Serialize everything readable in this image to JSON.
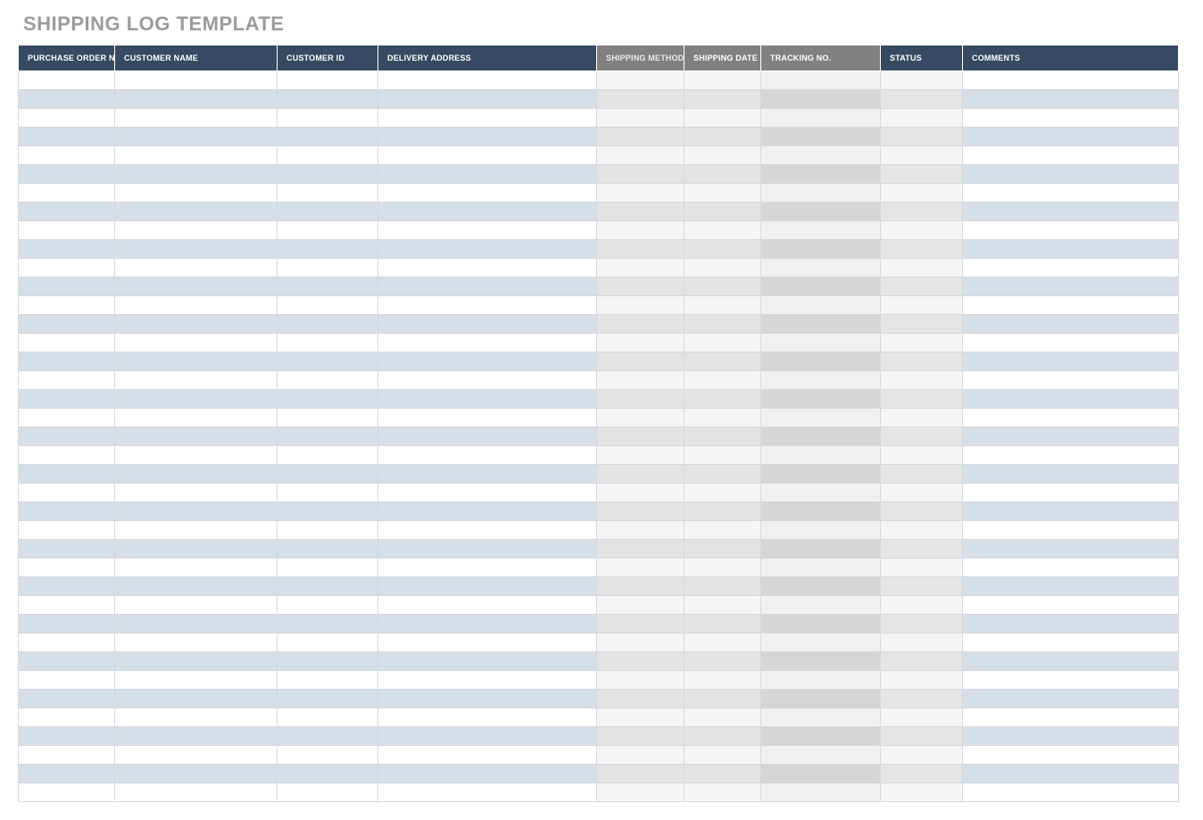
{
  "title": "SHIPPING LOG TEMPLATE",
  "columns": [
    {
      "key": "po",
      "label": "PURCHASE ORDER NO.",
      "zone": "blue"
    },
    {
      "key": "name",
      "label": "CUSTOMER NAME",
      "zone": "blue"
    },
    {
      "key": "id",
      "label": "CUSTOMER ID",
      "zone": "blue"
    },
    {
      "key": "addr",
      "label": "DELIVERY ADDRESS",
      "zone": "blue"
    },
    {
      "key": "method",
      "label": "SHIPPING METHOD",
      "zone": "gray1"
    },
    {
      "key": "date",
      "label": "SHIPPING DATE",
      "zone": "gray1"
    },
    {
      "key": "track",
      "label": "TRACKING NO.",
      "zone": "gray2"
    },
    {
      "key": "status",
      "label": "STATUS",
      "zone": "gray3"
    },
    {
      "key": "comments",
      "label": "COMMENTS",
      "zone": "blue"
    }
  ],
  "rows": [
    {
      "po": "",
      "name": "",
      "id": "",
      "addr": "",
      "method": "",
      "date": "",
      "track": "",
      "status": "",
      "comments": ""
    },
    {
      "po": "",
      "name": "",
      "id": "",
      "addr": "",
      "method": "",
      "date": "",
      "track": "",
      "status": "",
      "comments": ""
    },
    {
      "po": "",
      "name": "",
      "id": "",
      "addr": "",
      "method": "",
      "date": "",
      "track": "",
      "status": "",
      "comments": ""
    },
    {
      "po": "",
      "name": "",
      "id": "",
      "addr": "",
      "method": "",
      "date": "",
      "track": "",
      "status": "",
      "comments": ""
    },
    {
      "po": "",
      "name": "",
      "id": "",
      "addr": "",
      "method": "",
      "date": "",
      "track": "",
      "status": "",
      "comments": ""
    },
    {
      "po": "",
      "name": "",
      "id": "",
      "addr": "",
      "method": "",
      "date": "",
      "track": "",
      "status": "",
      "comments": ""
    },
    {
      "po": "",
      "name": "",
      "id": "",
      "addr": "",
      "method": "",
      "date": "",
      "track": "",
      "status": "",
      "comments": ""
    },
    {
      "po": "",
      "name": "",
      "id": "",
      "addr": "",
      "method": "",
      "date": "",
      "track": "",
      "status": "",
      "comments": ""
    },
    {
      "po": "",
      "name": "",
      "id": "",
      "addr": "",
      "method": "",
      "date": "",
      "track": "",
      "status": "",
      "comments": ""
    },
    {
      "po": "",
      "name": "",
      "id": "",
      "addr": "",
      "method": "",
      "date": "",
      "track": "",
      "status": "",
      "comments": ""
    },
    {
      "po": "",
      "name": "",
      "id": "",
      "addr": "",
      "method": "",
      "date": "",
      "track": "",
      "status": "",
      "comments": ""
    },
    {
      "po": "",
      "name": "",
      "id": "",
      "addr": "",
      "method": "",
      "date": "",
      "track": "",
      "status": "",
      "comments": ""
    },
    {
      "po": "",
      "name": "",
      "id": "",
      "addr": "",
      "method": "",
      "date": "",
      "track": "",
      "status": "",
      "comments": ""
    },
    {
      "po": "",
      "name": "",
      "id": "",
      "addr": "",
      "method": "",
      "date": "",
      "track": "",
      "status": "",
      "comments": ""
    },
    {
      "po": "",
      "name": "",
      "id": "",
      "addr": "",
      "method": "",
      "date": "",
      "track": "",
      "status": "",
      "comments": ""
    },
    {
      "po": "",
      "name": "",
      "id": "",
      "addr": "",
      "method": "",
      "date": "",
      "track": "",
      "status": "",
      "comments": ""
    },
    {
      "po": "",
      "name": "",
      "id": "",
      "addr": "",
      "method": "",
      "date": "",
      "track": "",
      "status": "",
      "comments": ""
    },
    {
      "po": "",
      "name": "",
      "id": "",
      "addr": "",
      "method": "",
      "date": "",
      "track": "",
      "status": "",
      "comments": ""
    },
    {
      "po": "",
      "name": "",
      "id": "",
      "addr": "",
      "method": "",
      "date": "",
      "track": "",
      "status": "",
      "comments": ""
    },
    {
      "po": "",
      "name": "",
      "id": "",
      "addr": "",
      "method": "",
      "date": "",
      "track": "",
      "status": "",
      "comments": ""
    },
    {
      "po": "",
      "name": "",
      "id": "",
      "addr": "",
      "method": "",
      "date": "",
      "track": "",
      "status": "",
      "comments": ""
    },
    {
      "po": "",
      "name": "",
      "id": "",
      "addr": "",
      "method": "",
      "date": "",
      "track": "",
      "status": "",
      "comments": ""
    },
    {
      "po": "",
      "name": "",
      "id": "",
      "addr": "",
      "method": "",
      "date": "",
      "track": "",
      "status": "",
      "comments": ""
    },
    {
      "po": "",
      "name": "",
      "id": "",
      "addr": "",
      "method": "",
      "date": "",
      "track": "",
      "status": "",
      "comments": ""
    },
    {
      "po": "",
      "name": "",
      "id": "",
      "addr": "",
      "method": "",
      "date": "",
      "track": "",
      "status": "",
      "comments": ""
    },
    {
      "po": "",
      "name": "",
      "id": "",
      "addr": "",
      "method": "",
      "date": "",
      "track": "",
      "status": "",
      "comments": ""
    },
    {
      "po": "",
      "name": "",
      "id": "",
      "addr": "",
      "method": "",
      "date": "",
      "track": "",
      "status": "",
      "comments": ""
    },
    {
      "po": "",
      "name": "",
      "id": "",
      "addr": "",
      "method": "",
      "date": "",
      "track": "",
      "status": "",
      "comments": ""
    },
    {
      "po": "",
      "name": "",
      "id": "",
      "addr": "",
      "method": "",
      "date": "",
      "track": "",
      "status": "",
      "comments": ""
    },
    {
      "po": "",
      "name": "",
      "id": "",
      "addr": "",
      "method": "",
      "date": "",
      "track": "",
      "status": "",
      "comments": ""
    },
    {
      "po": "",
      "name": "",
      "id": "",
      "addr": "",
      "method": "",
      "date": "",
      "track": "",
      "status": "",
      "comments": ""
    },
    {
      "po": "",
      "name": "",
      "id": "",
      "addr": "",
      "method": "",
      "date": "",
      "track": "",
      "status": "",
      "comments": ""
    },
    {
      "po": "",
      "name": "",
      "id": "",
      "addr": "",
      "method": "",
      "date": "",
      "track": "",
      "status": "",
      "comments": ""
    },
    {
      "po": "",
      "name": "",
      "id": "",
      "addr": "",
      "method": "",
      "date": "",
      "track": "",
      "status": "",
      "comments": ""
    },
    {
      "po": "",
      "name": "",
      "id": "",
      "addr": "",
      "method": "",
      "date": "",
      "track": "",
      "status": "",
      "comments": ""
    },
    {
      "po": "",
      "name": "",
      "id": "",
      "addr": "",
      "method": "",
      "date": "",
      "track": "",
      "status": "",
      "comments": ""
    },
    {
      "po": "",
      "name": "",
      "id": "",
      "addr": "",
      "method": "",
      "date": "",
      "track": "",
      "status": "",
      "comments": ""
    },
    {
      "po": "",
      "name": "",
      "id": "",
      "addr": "",
      "method": "",
      "date": "",
      "track": "",
      "status": "",
      "comments": ""
    },
    {
      "po": "",
      "name": "",
      "id": "",
      "addr": "",
      "method": "",
      "date": "",
      "track": "",
      "status": "",
      "comments": ""
    }
  ]
}
